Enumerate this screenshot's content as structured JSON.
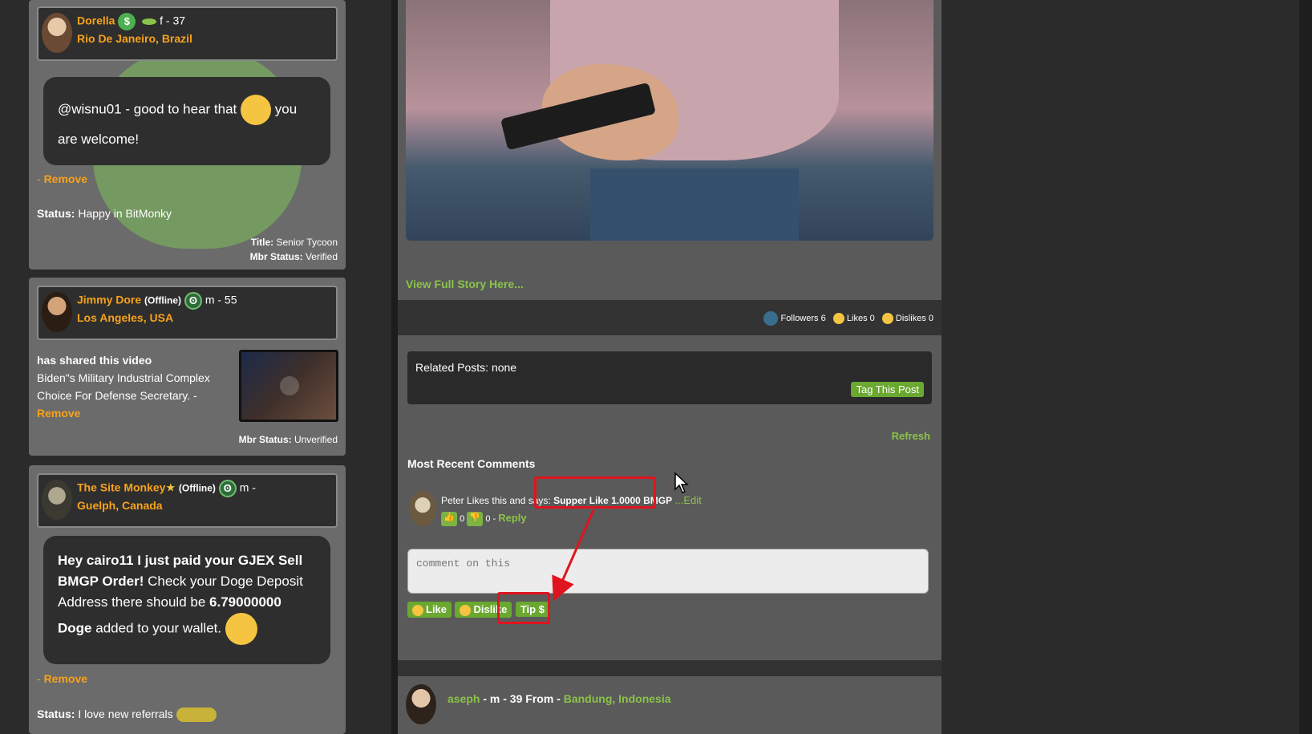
{
  "cards": [
    {
      "name": "Dorella",
      "name_suffix": "",
      "badge": "$",
      "demo": "f - 37",
      "city": "Rio De Janeiro",
      "country": "Brazil",
      "message_part1": "@wisnu01 - good to hear that",
      "message_part2": "you are welcome!",
      "remove": "Remove",
      "status_label": "Status:",
      "status_text": "Happy in BitMonky",
      "title_label": "Title:",
      "title_value": "Senior Tycoon",
      "mbr_label": "Mbr Status:",
      "mbr_value": "Verified"
    },
    {
      "name": "Jimmy Dore",
      "offline": "(Offline)",
      "demo": "m - 55",
      "city": "Los Angeles",
      "country": "USA",
      "shared": "has shared this video",
      "video_title": "Biden\"s Military Industrial Complex Choice For Defense Secretary. -",
      "remove": "Remove",
      "mbr_label": "Mbr Status:",
      "mbr_value": "Unverified"
    },
    {
      "name": "The Site Monkey",
      "offline": "(Offline)",
      "demo": "m -",
      "city": "Guelph",
      "country": "Canada",
      "msg_bold1": "Hey cairo11 I just paid your GJEX Sell BMGP Order!",
      "msg_normal1": "Check your Doge Deposit Address there should be",
      "msg_bold2": "6.79000000 Doge",
      "msg_normal2": "added to your wallet.",
      "remove": "Remove",
      "status_label": "Status:",
      "status_text": "I love new referrals"
    }
  ],
  "main": {
    "view_story": "View Full Story Here...",
    "followers": "Followers 6",
    "likes": "Likes 0",
    "dislikes": "Dislikes 0",
    "related": "Related Posts: none",
    "tag_button": "Tag This Post",
    "refresh": "Refresh",
    "recent_heading": "Most Recent Comments",
    "comment_prefix": "Peter Likes this and says:",
    "comment_text": "Supper Like 1.0000 BMGP",
    "edit": "...Edit",
    "up_count": "0",
    "down_count": "0 -",
    "reply": "Reply",
    "comment_placeholder": "comment on this",
    "like_btn": "Like",
    "dislike_btn": "Dislike",
    "tip_btn": "Tip $",
    "next_user": "aseph",
    "next_demo": "- m - 39 From -",
    "next_city": "Bandung",
    "next_country": "Indonesia"
  },
  "colors": {
    "accent_orange": "#f7a21b",
    "accent_green": "#8bc34a",
    "button_green": "#6aa830",
    "highlight_red": "#e0141e"
  }
}
